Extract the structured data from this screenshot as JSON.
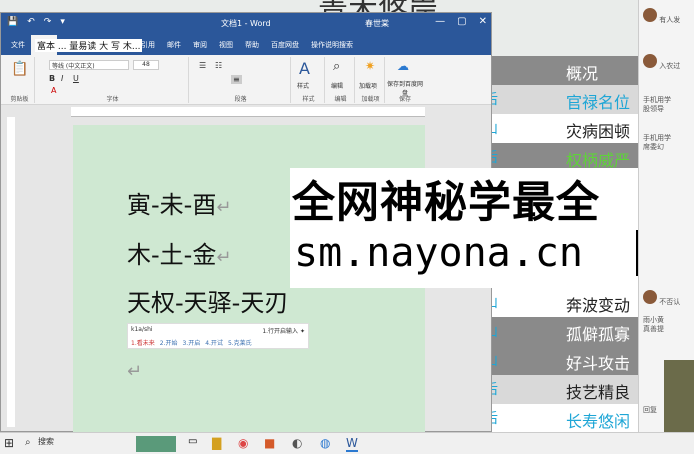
{
  "background": {
    "title": "青木悠岸",
    "table": {
      "header": "概况",
      "rows": [
        {
          "a": "后",
          "b": "官禄名位"
        },
        {
          "a": "山",
          "b": "灾病困顿"
        },
        {
          "a": "后",
          "b": "权柄威严"
        },
        {
          "a": "山",
          "b": "奔波变动"
        },
        {
          "a": "山",
          "b": "孤僻孤寡"
        },
        {
          "a": "山",
          "b": "好斗攻击"
        },
        {
          "a": "后",
          "b": "技艺精良"
        },
        {
          "a": "后",
          "b": "长寿悠闲"
        }
      ]
    }
  },
  "chat": {
    "items": [
      "有人发",
      "入农过",
      "手机用学",
      "股领导",
      "手机用学",
      "席委幻",
      "不否认",
      "雨小黄",
      "真善提",
      "回复"
    ]
  },
  "word": {
    "title": "文档1 - Word",
    "user": "春世棠",
    "quick_access": [
      "💾",
      "↶",
      "↷",
      "▾"
    ],
    "window_controls": [
      "—",
      "▢",
      "✕"
    ],
    "tabs": [
      "文件",
      "开始",
      "插入",
      "设计",
      "布局",
      "引用",
      "邮件",
      "审阅",
      "视图",
      "帮助",
      "百度网盘",
      "操作说明搜索"
    ],
    "floating_text": "富本 ... 量易读 大 写 木...",
    "ribbon": {
      "clipboard": "剪贴板",
      "font": "字体",
      "paragraph": "段落",
      "styles": "样式",
      "editing": "编辑",
      "accessibility": "加载项",
      "save": "保存",
      "font_name": "等线 (中文正文)",
      "font_size": "48",
      "styles_btn": "样式",
      "edit_btn": "编辑",
      "addin_btn": "加载项",
      "save_btn": "保存到百度网盘"
    },
    "lines": [
      "寅-未-酉",
      "木-土-金",
      "天权-天驿-天刃"
    ],
    "ime": {
      "pinyin": "k1a/shi",
      "hint": "1.行开启输入 ✦",
      "candidates": [
        "1.看未来",
        "2.开始",
        "3.开启",
        "4.开试",
        "5.克莱氏"
      ]
    }
  },
  "overlay": {
    "line1": "全网神秘学最全",
    "line2": "sm.nayona.cn"
  },
  "taskbar": {
    "search": "搜索",
    "start_icon": "windows-icon"
  }
}
